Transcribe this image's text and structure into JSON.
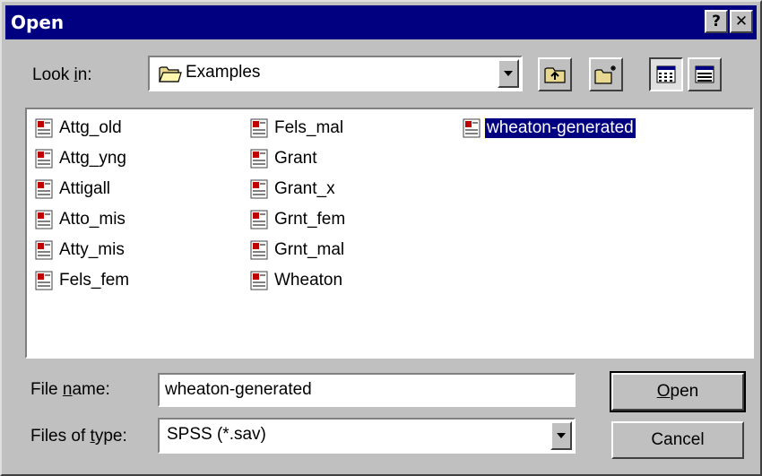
{
  "window": {
    "title": "Open",
    "help_button": "?",
    "close_button": "✕"
  },
  "look_in": {
    "label_pre": "Look ",
    "label_acc": "i",
    "label_post": "n:",
    "value": "Examples",
    "value_icon": "folder-icon"
  },
  "toolbar": {
    "up_one_level": "up-folder-icon",
    "create_new_folder": "new-folder-icon",
    "list_view": "list-view-icon",
    "details_view": "details-view-icon"
  },
  "files": [
    {
      "name": "Attg_old"
    },
    {
      "name": "Attg_yng"
    },
    {
      "name": "Attigall"
    },
    {
      "name": "Atto_mis"
    },
    {
      "name": "Atty_mis"
    },
    {
      "name": "Fels_fem"
    },
    {
      "name": "Fels_mal"
    },
    {
      "name": "Grant"
    },
    {
      "name": "Grant_x"
    },
    {
      "name": "Grnt_fem"
    },
    {
      "name": "Grnt_mal"
    },
    {
      "name": "Wheaton"
    },
    {
      "name": "wheaton-generated",
      "selected": true
    }
  ],
  "file_name": {
    "label_pre": "File ",
    "label_acc": "n",
    "label_post": "ame:",
    "value": "wheaton-generated"
  },
  "file_type": {
    "label_pre": "Files of ",
    "label_acc": "t",
    "label_post": "ype:",
    "value": "SPSS (*.sav)"
  },
  "buttons": {
    "open_acc": "O",
    "open_rest": "pen",
    "cancel": "Cancel"
  },
  "colors": {
    "titlebar": "#000080",
    "face": "#c0c0c0",
    "selection": "#000080"
  }
}
